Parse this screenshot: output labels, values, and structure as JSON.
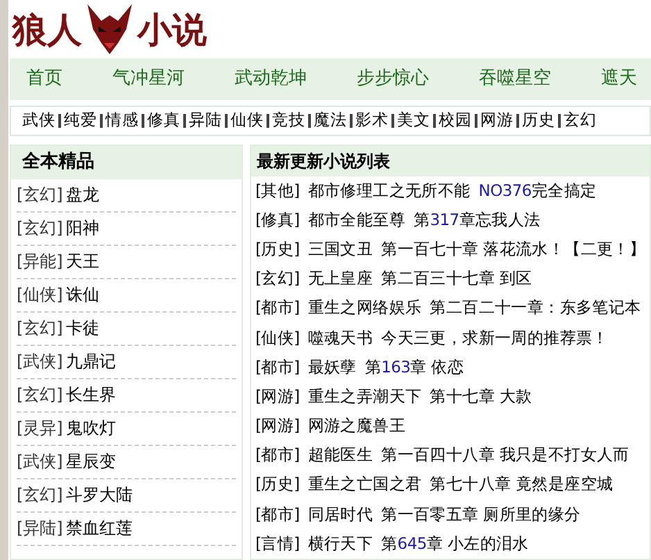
{
  "logo": {
    "left": "狼人",
    "right": "小说"
  },
  "nav": [
    "首页",
    "气冲星河",
    "武动乾坤",
    "步步惊心",
    "吞噬星空",
    "遮天"
  ],
  "categories": [
    "武侠",
    "纯爱",
    "情感",
    "修真",
    "异陆",
    "仙侠",
    "竞技",
    "魔法",
    "影术",
    "美文",
    "校园",
    "网游",
    "历史",
    "玄幻"
  ],
  "complete": {
    "title": "全本精品",
    "items": [
      {
        "genre": "[玄幻]",
        "title": "盘龙"
      },
      {
        "genre": "[玄幻]",
        "title": "阳神"
      },
      {
        "genre": "[异能]",
        "title": "天王"
      },
      {
        "genre": "[仙侠]",
        "title": "诛仙"
      },
      {
        "genre": "[玄幻]",
        "title": "卡徒"
      },
      {
        "genre": "[武侠]",
        "title": "九鼎记"
      },
      {
        "genre": "[玄幻]",
        "title": "长生界"
      },
      {
        "genre": "[灵异]",
        "title": "鬼吹灯"
      },
      {
        "genre": "[武侠]",
        "title": "星辰变"
      },
      {
        "genre": "[玄幻]",
        "title": "斗罗大陆"
      },
      {
        "genre": "[异陆]",
        "title": "禁血红莲"
      }
    ]
  },
  "latest": {
    "title": "最新更新小说列表",
    "rows": [
      {
        "genre": "[其他]",
        "title": "都市修理工之无所不能",
        "chapter": [
          {
            "text": "NO376",
            "highlight": true
          },
          {
            "text": "完全搞定",
            "highlight": false
          }
        ]
      },
      {
        "genre": "[修真]",
        "title": "都市全能至尊",
        "chapter": [
          {
            "text": "第",
            "highlight": false
          },
          {
            "text": "317",
            "highlight": true
          },
          {
            "text": "章忘我人法",
            "highlight": false
          }
        ]
      },
      {
        "genre": "[历史]",
        "title": "三国文丑",
        "chapter": [
          {
            "text": "第一百七十章 落花流水！【二更！】",
            "highlight": false
          }
        ]
      },
      {
        "genre": "[玄幻]",
        "title": "无上皇座",
        "chapter": [
          {
            "text": "第二百三十七章 到区",
            "highlight": false
          }
        ]
      },
      {
        "genre": "[都市]",
        "title": "重生之网络娱乐",
        "chapter": [
          {
            "text": "第二百二十一章：东多笔记本",
            "highlight": false
          }
        ]
      },
      {
        "genre": "[仙侠]",
        "title": "噬魂天书",
        "chapter": [
          {
            "text": "今天三更，求新一周的推荐票！",
            "highlight": false
          }
        ]
      },
      {
        "genre": "[都市]",
        "title": "最妖孽",
        "chapter": [
          {
            "text": "第",
            "highlight": false
          },
          {
            "text": "163",
            "highlight": true
          },
          {
            "text": "章 依恋",
            "highlight": false
          }
        ]
      },
      {
        "genre": "[网游]",
        "title": "重生之弄潮天下",
        "chapter": [
          {
            "text": "第十七章 大款",
            "highlight": false
          }
        ]
      },
      {
        "genre": "[网游]",
        "title": "网游之魔兽王",
        "chapter": []
      },
      {
        "genre": "[都市]",
        "title": "超能医生",
        "chapter": [
          {
            "text": "第一百四十八章 我只是不打女人而",
            "highlight": false
          }
        ]
      },
      {
        "genre": "[历史]",
        "title": "重生之亡国之君",
        "chapter": [
          {
            "text": "第七十八章 竟然是座空城",
            "highlight": false
          }
        ]
      },
      {
        "genre": "[都市]",
        "title": "同居时代",
        "chapter": [
          {
            "text": "第一百零五章 厕所里的缘分",
            "highlight": false
          }
        ]
      },
      {
        "genre": "[言情]",
        "title": "横行天下",
        "chapter": [
          {
            "text": "第",
            "highlight": false
          },
          {
            "text": "645",
            "highlight": true
          },
          {
            "text": "章 小左的泪水",
            "highlight": false
          }
        ]
      }
    ]
  }
}
